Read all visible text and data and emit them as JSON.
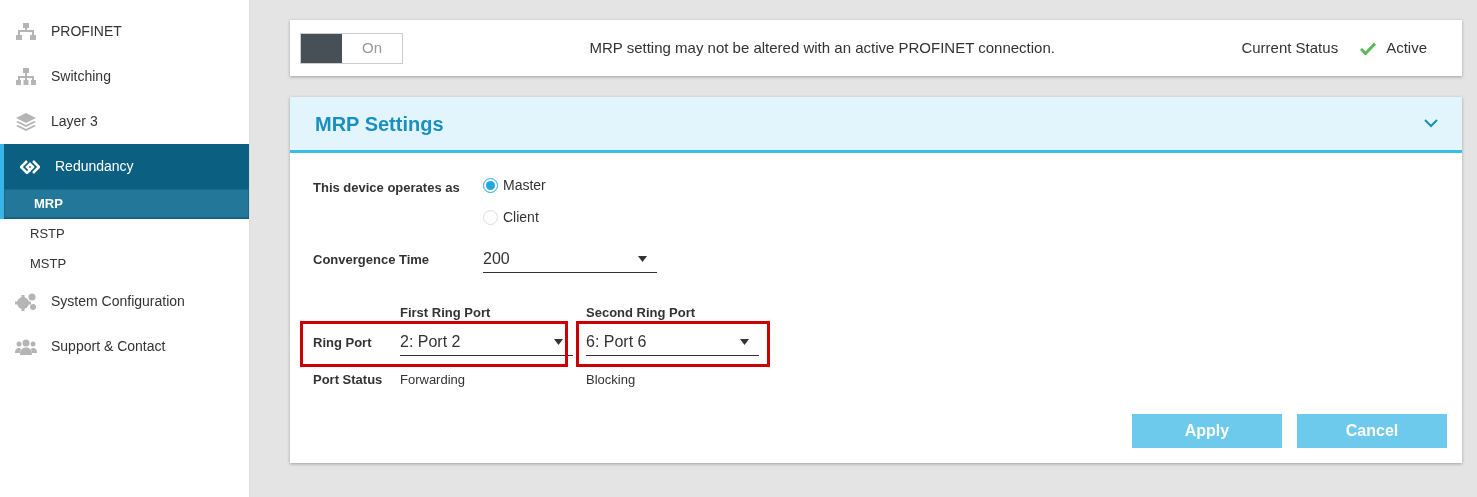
{
  "sidebar": {
    "items": [
      {
        "label": "PROFINET",
        "selected": false
      },
      {
        "label": "Switching",
        "selected": false
      },
      {
        "label": "Layer 3",
        "selected": false
      },
      {
        "label": "Redundancy",
        "selected": true,
        "children": [
          {
            "label": "MRP",
            "selected": true
          },
          {
            "label": "RSTP",
            "selected": false
          },
          {
            "label": "MSTP",
            "selected": false
          }
        ]
      },
      {
        "label": "System Configuration",
        "selected": false
      },
      {
        "label": "Support & Contact",
        "selected": false
      }
    ]
  },
  "status_card": {
    "toggle": {
      "label": "On",
      "on": true
    },
    "message": "MRP setting may not be altered with an active PROFINET connection.",
    "status_label": "Current Status",
    "status": "Active"
  },
  "settings": {
    "title": "MRP Settings",
    "expanded": true,
    "operates_as": {
      "label": "This device operates as",
      "options": [
        {
          "label": "Master",
          "selected": true
        },
        {
          "label": "Client",
          "selected": false
        }
      ]
    },
    "convergence": {
      "label": "Convergence Time",
      "value": "200"
    },
    "ring": {
      "label": "Ring Port",
      "status_label": "Port Status",
      "ports": [
        {
          "heading": "First Ring Port",
          "value": "2: Port 2",
          "status": "Forwarding",
          "highlighted": true
        },
        {
          "heading": "Second Ring Port",
          "value": "6: Port 6",
          "status": "Blocking",
          "highlighted": true
        }
      ]
    },
    "buttons": [
      "Apply",
      "Cancel"
    ]
  }
}
